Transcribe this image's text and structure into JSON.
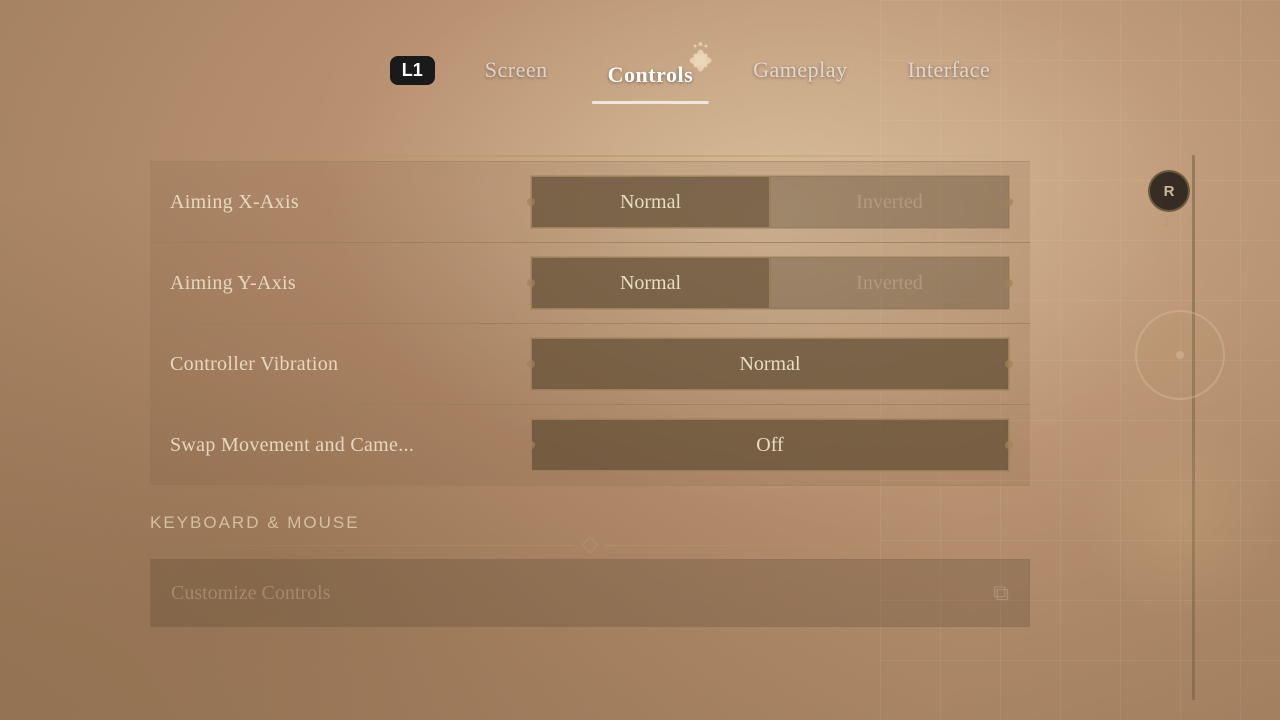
{
  "background": {
    "color_start": "#d4b896",
    "color_end": "#9a7a5a"
  },
  "header": {
    "l1_label": "L1",
    "tabs": [
      {
        "id": "screen",
        "label": "Screen",
        "active": false
      },
      {
        "id": "controls",
        "label": "Controls",
        "active": true
      },
      {
        "id": "gameplay",
        "label": "Gameplay",
        "active": false
      },
      {
        "id": "interface",
        "label": "Interface",
        "active": false
      }
    ]
  },
  "settings": {
    "rows": [
      {
        "id": "aiming-x-axis",
        "label": "Aiming X-Axis",
        "options": [
          "Normal",
          "Inverted"
        ],
        "selected": 0
      },
      {
        "id": "aiming-y-axis",
        "label": "Aiming Y-Axis",
        "options": [
          "Normal",
          "Inverted"
        ],
        "selected": 0
      },
      {
        "id": "controller-vibration",
        "label": "Controller Vibration",
        "options": [
          "Normal"
        ],
        "selected": 0
      },
      {
        "id": "swap-movement",
        "label": "Swap Movement and Came...",
        "options": [
          "Off"
        ],
        "selected": 0
      }
    ],
    "keyboard_section": {
      "title": "KEYBOARD & MOUSE",
      "customize_label": "Customize Controls"
    }
  },
  "indicators": {
    "r_button": "R",
    "r_arrow": "↓"
  }
}
